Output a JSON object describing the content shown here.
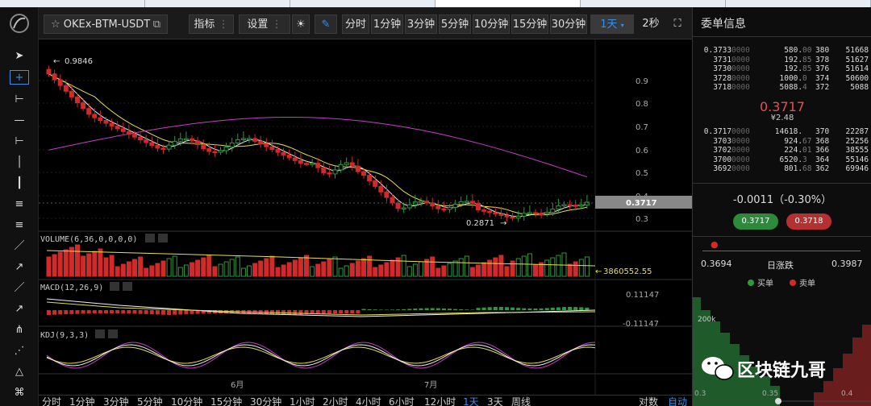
{
  "toolbar": {
    "symbol": "OKEx-BTM-USDT",
    "indicators_label": "指标",
    "settings_label": "设置",
    "intervals": [
      "分时",
      "1分钟",
      "3分钟",
      "5分钟",
      "10分钟",
      "15分钟",
      "30分钟"
    ],
    "selected_interval": "1天",
    "refresh_label": "2秒"
  },
  "chart": {
    "price_axis": [
      "0.9",
      "0.8",
      "0.7",
      "0.6",
      "0.5",
      "0.4",
      "0.3"
    ],
    "current_price_tag": "0.3717",
    "high_label": "0.9846",
    "low_label": "0.2871",
    "volume_label": "VOLUME(6,36,0,0,0,0)",
    "volume_value": "3860552.55",
    "macd_label": "MACD(12,26,9)",
    "macd_top": "0.11147",
    "macd_bottom": "-0.11147",
    "kdj_label": "KDJ(9,3,3)",
    "month_labels": [
      "6月",
      "7月"
    ]
  },
  "bottom_bar": {
    "intervals": [
      "分时",
      "1分钟",
      "3分钟",
      "5分钟",
      "10分钟",
      "15分钟",
      "30分钟",
      "1小时",
      "2小时",
      "4小时",
      "6小时",
      "12小时",
      "1天",
      "3天",
      "周线"
    ],
    "selected": "1天",
    "log_label": "对数",
    "auto_label": "自动"
  },
  "orderbook": {
    "title": "委单信息",
    "asks": [
      {
        "price": "0.3733",
        "price_dim": "0000",
        "amount": "580.",
        "amount_dim": "00",
        "count": "380",
        "total": "51668"
      },
      {
        "price": "3731",
        "price_dim": "0000",
        "amount": "192.",
        "amount_dim": "85",
        "count": "378",
        "total": "51627"
      },
      {
        "price": "3730",
        "price_dim": "0000",
        "amount": "192.",
        "amount_dim": "85",
        "count": "376",
        "total": "51614"
      },
      {
        "price": "3728",
        "price_dim": "0000",
        "amount": "1000.",
        "amount_dim": "0",
        "count": "374",
        "total": "50600"
      },
      {
        "price": "3718",
        "price_dim": "0000",
        "amount": "5088.",
        "amount_dim": "4",
        "count": "372",
        "total": "5088"
      }
    ],
    "last_price": "0.3717",
    "last_price_cny": "¥2.48",
    "bids": [
      {
        "price": "0.3717",
        "price_dim": "0000",
        "amount": "14618.",
        "amount_dim": "",
        "count": "370",
        "total": "22287"
      },
      {
        "price": "3703",
        "price_dim": "0000",
        "amount": "924.",
        "amount_dim": "67",
        "count": "368",
        "total": "25256"
      },
      {
        "price": "3702",
        "price_dim": "0000",
        "amount": "224.",
        "amount_dim": "01",
        "count": "366",
        "total": "38555"
      },
      {
        "price": "3700",
        "price_dim": "0000",
        "amount": "6520.",
        "amount_dim": "3",
        "count": "364",
        "total": "55146"
      },
      {
        "price": "3692",
        "price_dim": "0000",
        "amount": "801.",
        "amount_dim": "68",
        "count": "362",
        "total": "69946"
      }
    ],
    "change": "-0.0011（-0.30%）",
    "buy_price": "0.3717",
    "sell_price": "0.3718",
    "range_low": "0.3694",
    "range_label": "日涨跌",
    "range_high": "0.3987",
    "legend_buy": "买单",
    "legend_sell": "卖单",
    "depth_axis_label": "200k",
    "depth_x_ticks": [
      "0.3",
      "0.35",
      "0.4"
    ],
    "watermark": "区块链九哥"
  },
  "colors": {
    "up": "#2d9a3a",
    "down": "#d12a2a",
    "ma_short": "#f2f2f2",
    "ma_mid": "#e6e04a",
    "ma_long": "#c83cc8",
    "accent": "#3a8ee6"
  }
}
